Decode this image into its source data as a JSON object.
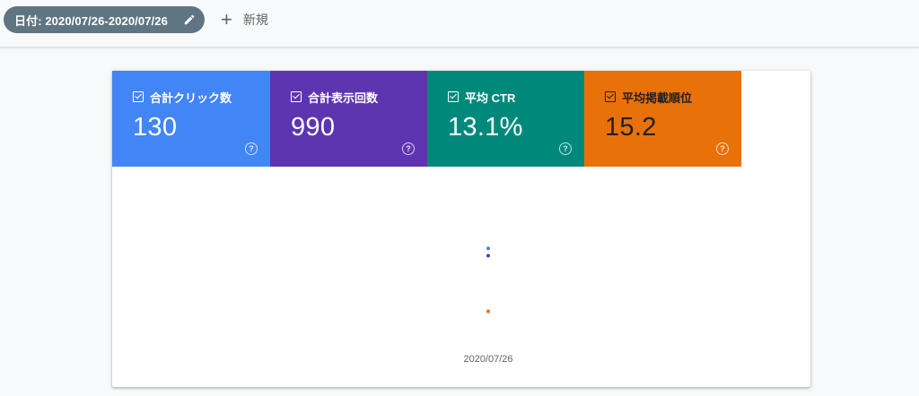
{
  "toolbar": {
    "date_filter_label": "日付: 2020/07/26-2020/07/26",
    "new_label": "新規"
  },
  "metrics": [
    {
      "label": "合計クリック数",
      "value": "130",
      "color": "#4285f4"
    },
    {
      "label": "合計表示回数",
      "value": "990",
      "color": "#5e35b1"
    },
    {
      "label": "平均 CTR",
      "value": "13.1%",
      "color": "#00897b"
    },
    {
      "label": "平均掲載順位",
      "value": "15.2",
      "color": "#e8710a"
    }
  ],
  "chart_data": {
    "type": "scatter",
    "x": [
      "2020/07/26"
    ],
    "series": [
      {
        "values": [
          130
        ],
        "color": "#4285f4"
      },
      {
        "values": [
          990
        ],
        "color": "#5e35b1"
      },
      {
        "values": [
          13.1
        ],
        "color": "#00897b"
      },
      {
        "values": [
          15.2
        ],
        "color": "#e8710a"
      }
    ],
    "xlabel": "",
    "ylabel": "",
    "grid": false
  }
}
